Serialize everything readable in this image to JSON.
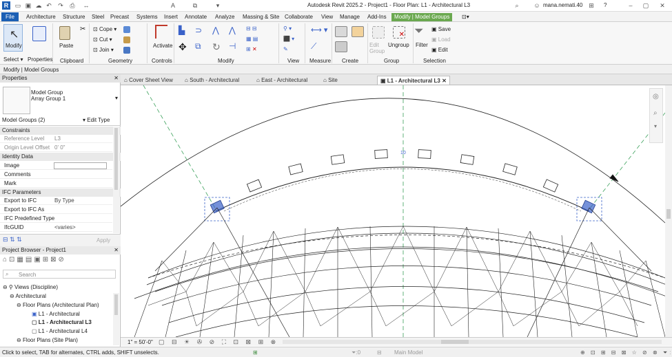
{
  "window": {
    "title": "Autodesk Revit 2025.2 - Project1 - Floor Plan: L1 - Architectural L3",
    "user": "mana.nemati.40",
    "help": "?"
  },
  "ribbon_tabs": [
    "File",
    "Architecture",
    "Structure",
    "Steel",
    "Precast",
    "Systems",
    "Insert",
    "Annotate",
    "Analyze",
    "Massing & Site",
    "Collaborate",
    "View",
    "Manage",
    "Add-Ins",
    "Modify | Model Groups"
  ],
  "ribbon": {
    "modify": "Modify",
    "select": "Select",
    "properties": "Properties",
    "paste": "Paste",
    "clipboard": "Clipboard",
    "cope": "Cope",
    "cut": "Cut",
    "join": "Join",
    "geometry": "Geometry",
    "activate": "Activate",
    "controls": "Controls",
    "modify_panel": "Modify",
    "view": "View",
    "measure": "Measure",
    "create": "Create",
    "edit_group": "Edit Group",
    "ungroup": "Ungroup",
    "group": "Group",
    "filter": "Filter",
    "save": "Save",
    "load": "Load",
    "edit": "Edit",
    "selection": "Selection"
  },
  "options_bar": "Modify | Model Groups",
  "properties": {
    "title": "Properties",
    "type_line1": "Model Group",
    "type_line2": "Array Group 1",
    "selector": "Model Groups (2)",
    "edit_type": "Edit Type",
    "sections": {
      "constraints": "Constraints",
      "identity": "Identity Data",
      "ifc": "IFC Parameters"
    },
    "rows": {
      "ref_level": [
        "Reference Level",
        "L3"
      ],
      "origin_offset": [
        "Origin Level Offset",
        "0'  0\""
      ],
      "image": [
        "Image",
        ""
      ],
      "comments": [
        "Comments",
        ""
      ],
      "mark": [
        "Mark",
        ""
      ],
      "export_ifc": [
        "Export to IFC",
        "By Type"
      ],
      "export_ifc_as": [
        "Export to IFC As",
        ""
      ],
      "ifc_predef": [
        "IFC Predefined Type",
        ""
      ],
      "ifcguid": [
        "IfcGUID",
        "<varies>"
      ]
    },
    "apply": "Apply"
  },
  "browser": {
    "title": "Project Browser - Project1",
    "search": "Search",
    "items": [
      "Views (Discipline)",
      "Architectural",
      "Floor Plans (Architectural Plan)",
      "L1 - Architectural",
      "L1 - Architectural L3",
      "L1 - Architectural L4",
      "Floor Plans (Site Plan)"
    ]
  },
  "view_tabs": [
    "Cover Sheet View",
    "South - Architectural",
    "East - Architectural",
    "Site",
    "L1 - Architectural L3"
  ],
  "canvas": {
    "dim_label": "10"
  },
  "view_bar": {
    "scale": "1\" = 50'-0\""
  },
  "status": {
    "hint": "Click to select, TAB for alternates, CTRL adds, SHIFT unselects.",
    "zero": ":0",
    "model": "Main Model"
  },
  "colors": {
    "file_tab": "#1c5fb4",
    "context_tab": "#6aa84f",
    "selection": "#3a62c9"
  }
}
